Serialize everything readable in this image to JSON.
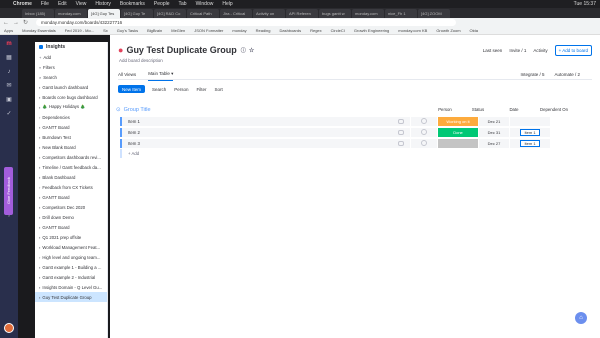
{
  "macbar": {
    "apple": "",
    "app": "Chrome",
    "menus": [
      "File",
      "Edit",
      "View",
      "History",
      "Bookmarks",
      "People",
      "Tab",
      "Window",
      "Help"
    ],
    "clock": "Tue 15:37"
  },
  "browser": {
    "tabs": [
      "Inbox (185)",
      "monday.com",
      "[4G] Guy Tes",
      "[4G] Guy Te",
      "[4G] R&D Co",
      "Critical Path",
      "Jira - Critical",
      "Activity on",
      "API Referen",
      "bugs gantt w",
      "monday.com",
      "nice_Fh 1",
      "[4G] ZOOM"
    ],
    "url": "monday.monday.com/boards/432227716",
    "bookmarks": [
      "Apps",
      "Monday Essentials",
      "Fed 2019 - Mo...",
      "Sx",
      "Guy's Tasks",
      "BigBrain",
      "MeGlen",
      "JSON Formatter",
      "monday",
      "Reading",
      "Dashboards",
      "Regex",
      "CircleCI",
      "Growth Engineering",
      "monday.com KB",
      "Growth Zoom",
      "Okta"
    ]
  },
  "rail": {
    "icons": [
      "monday-logo",
      "grid-icon",
      "bell-icon",
      "inbox-icon",
      "calendar-icon",
      "check-icon",
      "people-icon",
      "search-icon",
      "help-icon"
    ],
    "feedback": "Give Feedback"
  },
  "sidebar": {
    "workspace": "Insights",
    "add": "Add",
    "filters": "Filters",
    "search": "Search",
    "items": [
      "Gantt launch dashboard",
      "Boards core bugs dashboard",
      "🎄 Happy Holidays 🎄",
      "Dependencies",
      "GANTT Board",
      "Burndown Test",
      "New Blank Board",
      "Competitors dashboards revi...",
      "Timeline / Gantt feedback da...",
      "Blank Dashboard",
      "Feedback from CX Tickets",
      "GANTT Board",
      "Competitors Dec 2020",
      "Drill down Demo",
      "GANTT Board",
      "Q1 2021 prep offsite",
      "Workload Management Feat...",
      "High level and ongoing team...",
      "Gantt example 1 - Building a ...",
      "Gantt example 2 - Industrial",
      "Insights Domain - Q Level Gu...",
      "Guy Test Duplicate Group"
    ]
  },
  "board": {
    "title": "Guy Test Duplicate Group",
    "desc": "Add board description",
    "last_seen": "Last seen",
    "invite": "Invite / 1",
    "activity": "Activity",
    "add_board": "+ Add to board",
    "views": [
      "All Views",
      "Main Table ▾"
    ],
    "integrate": "Integrate / 5",
    "automate": "Automate / 2",
    "toolbar": {
      "new_item": "New Item",
      "search": "Search",
      "person": "Person",
      "filter": "Filter",
      "sort": "Sort"
    }
  },
  "table": {
    "group": "Group Title",
    "columns": [
      "Person",
      "Status",
      "Date",
      "Dependent On"
    ],
    "rows": [
      {
        "name": "Item 1",
        "status": "Working on it",
        "status_color": "#fdab3d",
        "date": "Dec 21",
        "dep": ""
      },
      {
        "name": "Item 2",
        "status": "Done",
        "status_color": "#00c875",
        "date": "Dec 31",
        "dep": "Item 1"
      },
      {
        "name": "Item 3",
        "status": "",
        "status_color": "#c4c4c4",
        "date": "Dec 27",
        "dep": "Item 1"
      }
    ],
    "add_item": "+ Add"
  }
}
